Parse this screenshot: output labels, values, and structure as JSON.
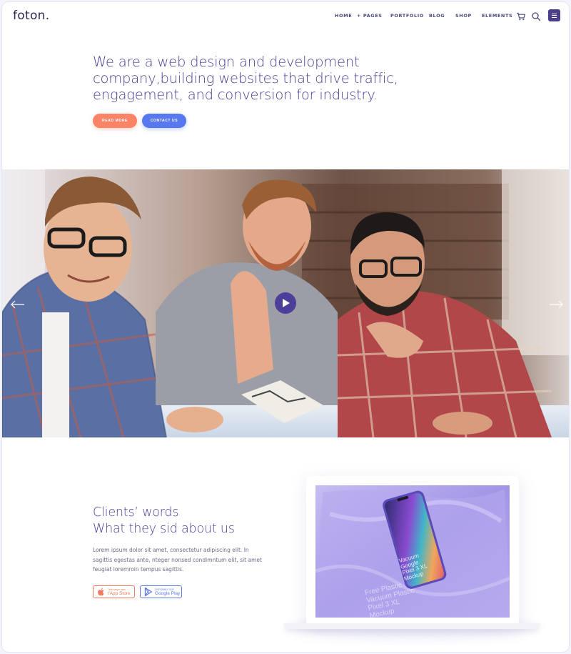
{
  "header": {
    "logo": "foton.",
    "nav": {
      "home": "HOME",
      "pages": "+ PAGES",
      "portfolio": "PORTFOLIO",
      "blog": "BLOG",
      "shop": "SHOP",
      "elements": "ELEMENTS"
    },
    "icons": [
      "cart-icon",
      "search-icon",
      "menu-icon"
    ]
  },
  "hero": {
    "headline_line1": "We are a web design and development",
    "headline_line2": "company,building websites that drive traffic,",
    "headline_line3": "engagement, and conversion for industry.",
    "read_more": "READ MORE",
    "contact_us": "CONTACT US"
  },
  "slider": {
    "prev_icon": "arrow-left-icon",
    "next_icon": "arrow-right-icon",
    "play_icon": "play-icon"
  },
  "clients": {
    "title_line1": "Clients’ words",
    "title_line2": "What they sid about us",
    "body": "Lorem ipsum dolor sit amet, consectetur adipiscing elit. In sagittis egestas ante, nteger nonsed condimntum elit, sit amet feugiat loremroin tempus sagittis.",
    "appstore_small": "Télécharger dans",
    "appstore_big": "l'App Store",
    "googleplay_small": "DISPONIBLE SUR",
    "googleplay_big": "Google Play"
  },
  "mockup": {
    "phone_text": [
      "Vacuum",
      "Google",
      "Pixel 3 XL",
      "Mockup"
    ],
    "bag_text": [
      "Free Plastic",
      "Vacuum Plastic",
      "Pixel 3 XL",
      "Mockup"
    ]
  },
  "colors": {
    "accent_purple": "#4b3f9a",
    "read_more": "#fb8466",
    "contact_us": "#5878f0",
    "screen_bg": "#a99ee9"
  }
}
